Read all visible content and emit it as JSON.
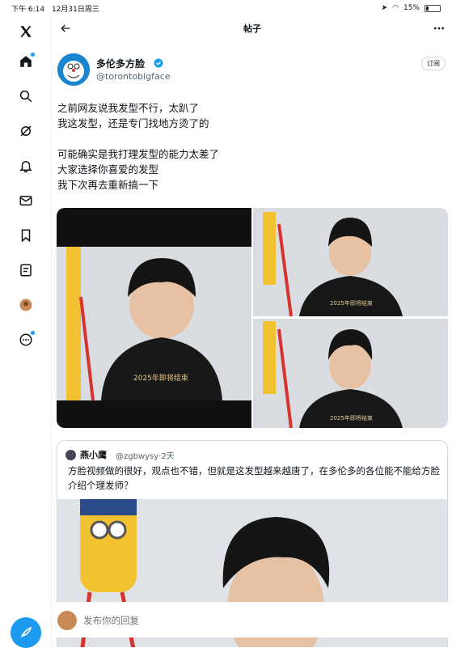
{
  "status_bar": {
    "time": "下午 6:14",
    "date": "12月31日周三",
    "battery": "15%"
  },
  "sidebar": {
    "items": [
      {
        "name": "x-logo"
      },
      {
        "name": "home"
      },
      {
        "name": "explore"
      },
      {
        "name": "grok"
      },
      {
        "name": "notifications"
      },
      {
        "name": "messages"
      },
      {
        "name": "bookmarks"
      },
      {
        "name": "lists"
      },
      {
        "name": "profile"
      },
      {
        "name": "more"
      }
    ],
    "accent": "#1d9bf0"
  },
  "header": {
    "title": "帖子"
  },
  "post": {
    "author_name": "多伦多方脸",
    "author_handle": "@torontobigface",
    "subscribe_label": "订阅",
    "text": "之前网友说我发型不行，太趴了\n我这发型，还是专门找地方烫了的\n\n可能确实是我打理发型的能力太差了\n大家选择你喜爱的发型\n我下次再去重新搞一下",
    "image_captions": [
      "2025年即将结束",
      "2025年即将结束",
      "2025年即将结束"
    ]
  },
  "quote": {
    "author_name": "燕小鹰",
    "author_handle": "@zgbwysy·2天",
    "text": "方脸视频做的很好，观点也不错，但就是这发型越来越唐了，在多伦多的各位能不能给方脸介绍个理发师？"
  },
  "reply": {
    "placeholder": "发布你的回复"
  }
}
